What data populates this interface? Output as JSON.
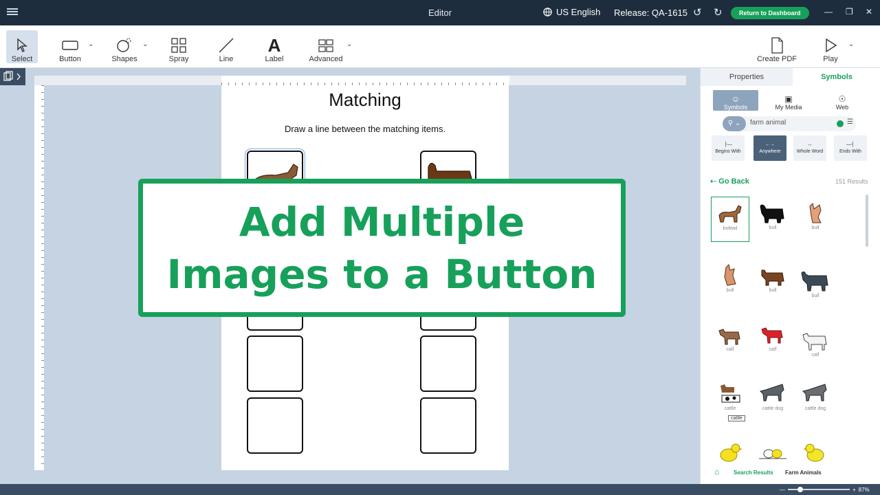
{
  "titlebar": {
    "title": "Editor",
    "language": "US English",
    "release": "Release: QA-1615",
    "return_button": "Return to Dashboard"
  },
  "toolbar": {
    "tools": [
      {
        "label": "Select",
        "icon": "cursor-icon"
      },
      {
        "label": "Button",
        "icon": "rectangle-icon"
      },
      {
        "label": "Shapes",
        "icon": "shapes-icon"
      },
      {
        "label": "Spray",
        "icon": "grid-icon"
      },
      {
        "label": "Line",
        "icon": "line-icon"
      },
      {
        "label": "Label",
        "icon": "letter-a-icon"
      },
      {
        "label": "Advanced",
        "icon": "advanced-icon"
      }
    ],
    "create_pdf": "Create PDF",
    "play": "Play"
  },
  "page": {
    "title": "Matching",
    "instruction": "Draw a line between the matching items."
  },
  "banner": {
    "text": "Add Multiple Images to a Button"
  },
  "panel": {
    "tabs": [
      "Properties",
      "Symbols"
    ],
    "sources": [
      "Symbols",
      "My Media",
      "Web"
    ],
    "search_value": "farm animal",
    "modes": [
      "Begins With",
      "Anywhere",
      "Whole Word",
      "Ends With"
    ],
    "go_back": "Go Back",
    "results": "151 Results",
    "symbols": [
      {
        "label": "bobtail"
      },
      {
        "label": "bull"
      },
      {
        "label": "bull"
      },
      {
        "label": "bull"
      },
      {
        "label": "bull"
      },
      {
        "label": "bull"
      },
      {
        "label": "calf"
      },
      {
        "label": "calf"
      },
      {
        "label": "calf"
      },
      {
        "label": "cattle"
      },
      {
        "label": "cattle dog"
      },
      {
        "label": "cattle dog"
      },
      {
        "label": ""
      },
      {
        "label": ""
      },
      {
        "label": ""
      }
    ],
    "tooltip": "cattle",
    "breadcrumbs": [
      "Search Results",
      "Farm Animals"
    ]
  },
  "status": {
    "zoom": "87%"
  },
  "colors": {
    "accent": "#17a05a",
    "titlebar": "#1e2d3d",
    "canvas_bg": "#c5d3e3"
  }
}
